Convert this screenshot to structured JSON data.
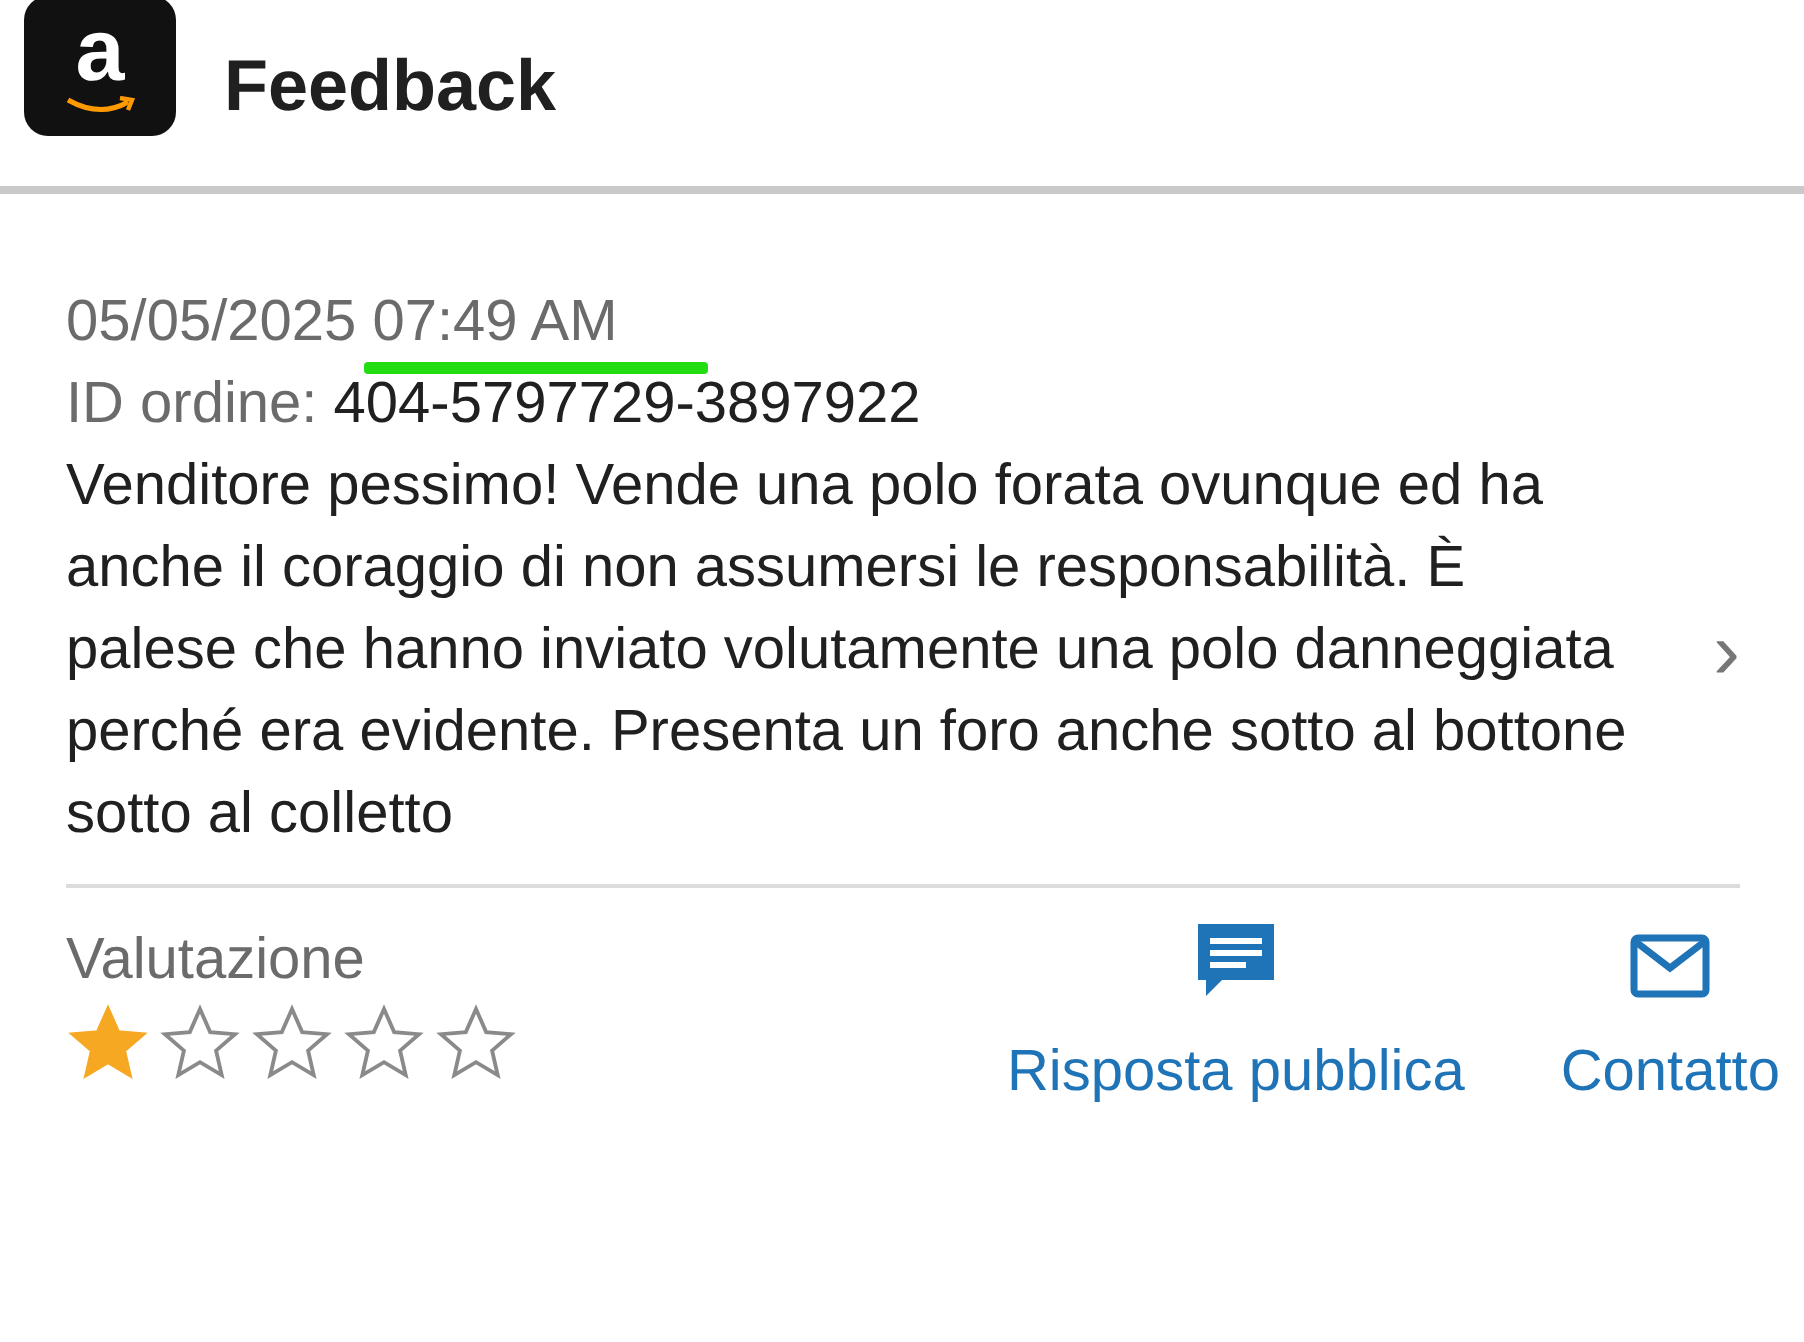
{
  "app_bar": {
    "logo_letter": "a",
    "title": "Feedback"
  },
  "feedback": {
    "date": "05/05/2025",
    "time": "07:49 AM",
    "order_label": "ID ordine:",
    "order_id": "404-5797729-3897922",
    "comment": "Venditore pessimo! Vende una polo forata ovunque ed ha anche il coraggio di non assumersi le responsabilità. È palese che hanno inviato volutamente una polo danneggiata perché era evidente. Presenta un foro anche sotto al bottone sotto al colletto",
    "chevron": "›",
    "rating_label": "Valutazione",
    "stars": 1
  },
  "actions": [
    {
      "kind": "reply",
      "label": "Risposta pubblica"
    },
    {
      "kind": "contact",
      "label": "Contatto"
    }
  ]
}
